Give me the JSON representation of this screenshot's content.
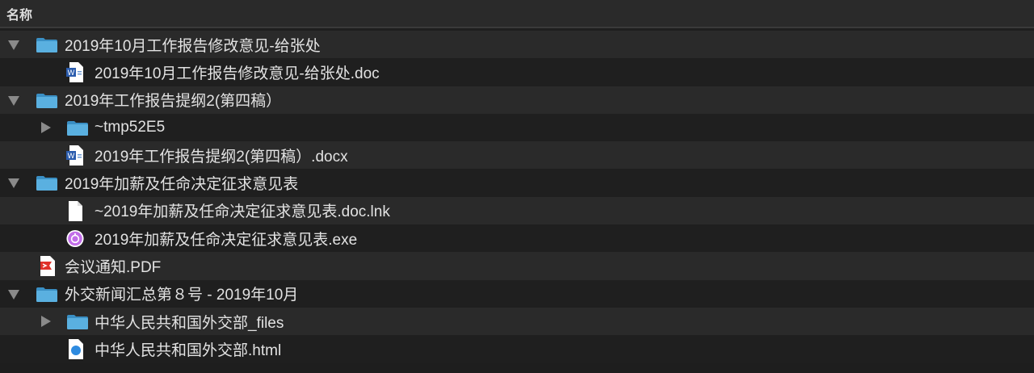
{
  "header": {
    "name_column": "名称"
  },
  "colors": {
    "folder": "#4aa3d6",
    "word": "#2b5cad",
    "pdf": "#e0322b",
    "exe": "#b14fe0",
    "html": "#2e8be0"
  },
  "items": [
    {
      "label": "2019年10月工作报告修改意见-给张处",
      "level": 0,
      "icon": "folder-icon",
      "disclosure": "expanded"
    },
    {
      "label": "2019年10月工作报告修改意见-给张处.doc",
      "level": 1,
      "icon": "word-document-icon",
      "disclosure": "none"
    },
    {
      "label": "2019年工作报告提纲2(第四稿）",
      "level": 0,
      "icon": "folder-icon",
      "disclosure": "expanded"
    },
    {
      "label": "~tmp52E5",
      "level": 1,
      "icon": "folder-icon",
      "disclosure": "collapsed"
    },
    {
      "label": "2019年工作报告提纲2(第四稿）.docx",
      "level": 1,
      "icon": "word-document-icon",
      "disclosure": "none"
    },
    {
      "label": "2019年加薪及任命决定征求意见表",
      "level": 0,
      "icon": "folder-icon",
      "disclosure": "expanded"
    },
    {
      "label": "~2019年加薪及任命决定征求意见表.doc.lnk",
      "level": 1,
      "icon": "blank-document-icon",
      "disclosure": "none"
    },
    {
      "label": "2019年加薪及任命决定征求意见表.exe",
      "level": 1,
      "icon": "executable-icon",
      "disclosure": "none"
    },
    {
      "label": "会议通知.PDF",
      "level": 0,
      "icon": "pdf-document-icon",
      "disclosure": "none"
    },
    {
      "label": "外交新闻汇总第８号 - 2019年10月",
      "level": 0,
      "icon": "folder-icon",
      "disclosure": "expanded"
    },
    {
      "label": "中华人民共和国外交部_files",
      "level": 1,
      "icon": "folder-icon",
      "disclosure": "collapsed"
    },
    {
      "label": "中华人民共和国外交部.html",
      "level": 1,
      "icon": "html-document-icon",
      "disclosure": "none"
    }
  ]
}
